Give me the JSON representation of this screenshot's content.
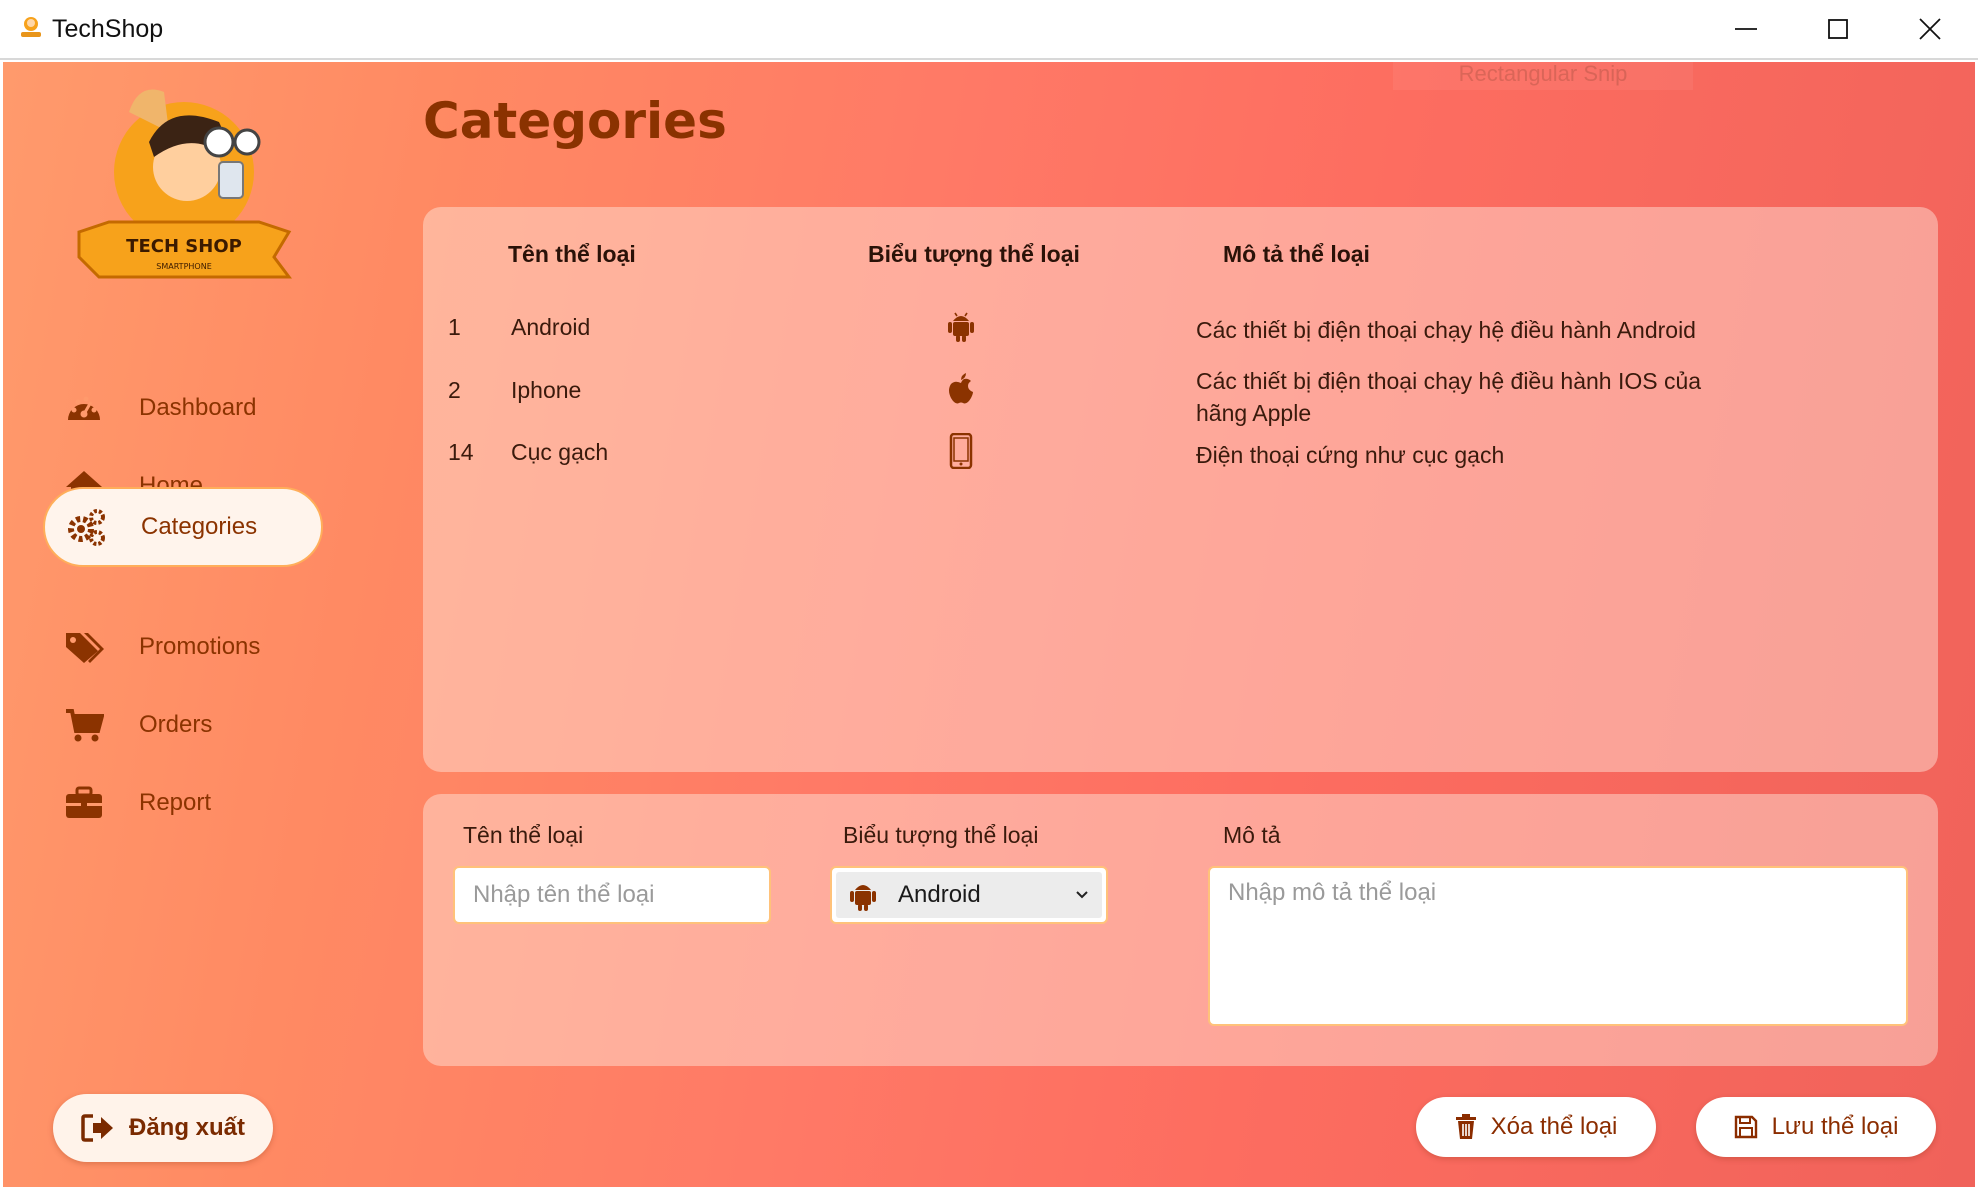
{
  "window": {
    "title": "TechShop",
    "icon": "techshop-app-icon",
    "controls": [
      "minimize-icon",
      "maximize-icon",
      "close-icon"
    ]
  },
  "overlay": {
    "ghost_label": "Rectangular Snip"
  },
  "logo": {
    "text": "TECH SHOP",
    "subtext": "SMARTPHONE"
  },
  "sidebar": {
    "items": [
      {
        "label": "Dashboard",
        "icon": "dashboard-gauge-icon",
        "active": false
      },
      {
        "label": "Home",
        "icon": "home-icon",
        "active": false
      },
      {
        "label": "Categories",
        "icon": "gears-icon",
        "active": true
      },
      {
        "label": "Promotions",
        "icon": "tags-icon",
        "active": false
      },
      {
        "label": "Orders",
        "icon": "cart-icon",
        "active": false
      },
      {
        "label": "Report",
        "icon": "briefcase-icon",
        "active": false
      }
    ],
    "logout_label": "Đăng xuất"
  },
  "main": {
    "title": "Categories",
    "table": {
      "headers": [
        "Tên thể loại",
        "Biểu tượng thể loại",
        "Mô tả thể loại"
      ],
      "rows": [
        {
          "id": "1",
          "name": "Android",
          "icon": "android-icon",
          "description": "Các thiết bị điện thoại chạy hệ điều hành Android"
        },
        {
          "id": "2",
          "name": "Iphone",
          "icon": "apple-icon",
          "description": "Các thiết bị điện thoại chạy hệ điều hành IOS của hãng Apple"
        },
        {
          "id": "14",
          "name": "Cục gạch",
          "icon": "mobile-phone-icon",
          "description": "Điện thoại cứng như cục gạch"
        }
      ]
    },
    "form": {
      "name_label": "Tên thể loại",
      "name_placeholder": "Nhập tên thể loại",
      "icon_label": "Biểu tượng thể loại",
      "icon_selected": "Android",
      "desc_label": "Mô tả",
      "desc_placeholder": "Nhập mô tả thể loại"
    },
    "actions": {
      "delete_label": "Xóa thể loại",
      "save_label": "Lưu thể loại"
    }
  },
  "colors": {
    "accent_text": "#8a3200",
    "border_accent": "#ffae5a",
    "gradient_start": "#ff9a6c",
    "gradient_end": "#f0625a"
  }
}
